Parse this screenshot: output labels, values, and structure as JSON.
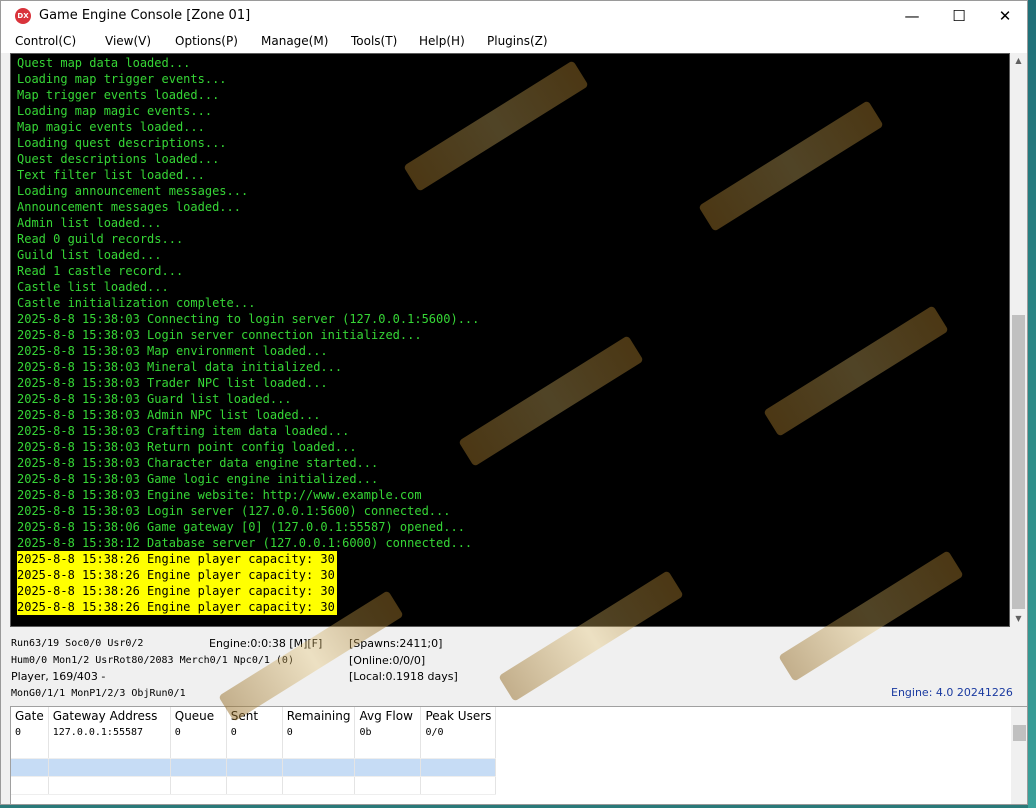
{
  "window": {
    "app_icon": "DX",
    "title": "Game Engine Console [Zone 01]",
    "controls": {
      "minimize": "—",
      "maximize": "☐",
      "close": "✕"
    }
  },
  "menu": [
    "Control(C)",
    "View(V)",
    "Options(P)",
    "Manage(M)",
    "Tools(T)",
    "Help(H)",
    "Plugins(Z)"
  ],
  "log": {
    "lines": [
      "Quest map data loaded...",
      "Loading map trigger events...",
      "Map trigger events loaded...",
      "Loading map magic events...",
      "Map magic events loaded...",
      "Loading quest descriptions...",
      "Quest descriptions loaded...",
      "Text filter list loaded...",
      "Loading announcement messages...",
      "Announcement messages loaded...",
      "Admin list loaded...",
      "Read 0 guild records...",
      "Guild list loaded...",
      "Read 1 castle record...",
      "Castle list loaded...",
      "Castle initialization complete...",
      "2025-8-8 15:38:03 Connecting to login server (127.0.0.1:5600)...",
      "2025-8-8 15:38:03 Login server connection initialized...",
      "2025-8-8 15:38:03 Map environment loaded...",
      "2025-8-8 15:38:03 Mineral data initialized...",
      "2025-8-8 15:38:03 Trader NPC list loaded...",
      "2025-8-8 15:38:03 Guard list loaded...",
      "2025-8-8 15:38:03 Admin NPC list loaded...",
      "2025-8-8 15:38:03 Crafting item data loaded...",
      "2025-8-8 15:38:03 Return point config loaded...",
      "2025-8-8 15:38:03 Character data engine started...",
      "2025-8-8 15:38:03 Game logic engine initialized...",
      "2025-8-8 15:38:03 Engine website: http://www.example.com",
      "2025-8-8 15:38:03 Login server (127.0.0.1:5600) connected...",
      "2025-8-8 15:38:06 Game gateway [0] (127.0.0.1:55587) opened...",
      "2025-8-8 15:38:12 Database server (127.0.0.1:6000) connected..."
    ],
    "highlighted": [
      "2025-8-8 15:38:26 Engine player capacity: 30",
      "2025-8-8 15:38:26 Engine player capacity: 30",
      "2025-8-8 15:38:26 Engine player capacity: 30",
      "2025-8-8 15:38:26 Engine player capacity: 30"
    ]
  },
  "status": {
    "line1_left": "Run63/19 Soc0/0 Usr0/2",
    "line1_mid": "Engine:0:0:38 [M][F]",
    "line1_right": "[Spawns:2411;0]",
    "line2_left": "Hum0/0 Mon1/2 UsrRot80/2083 Merch0/1 Npc0/1 (0)",
    "line2_right": "[Online:0/0/0]",
    "line3_left": "Player, 169/403 -",
    "line3_right": "[Local:0.1918 days]",
    "line4_left": "MonG0/1/1 MonP1/2/3 ObjRun0/1",
    "engine_version": "Engine: 4.0 20241226"
  },
  "gateway_table": {
    "headers": [
      "Gate",
      "Gateway Address",
      "Queue",
      "Sent",
      "Remaining",
      "Avg Flow",
      "Peak Users"
    ],
    "rows": [
      [
        "0",
        "127.0.0.1:55587",
        "0",
        "0",
        "0",
        "0b",
        "0/0"
      ]
    ]
  }
}
